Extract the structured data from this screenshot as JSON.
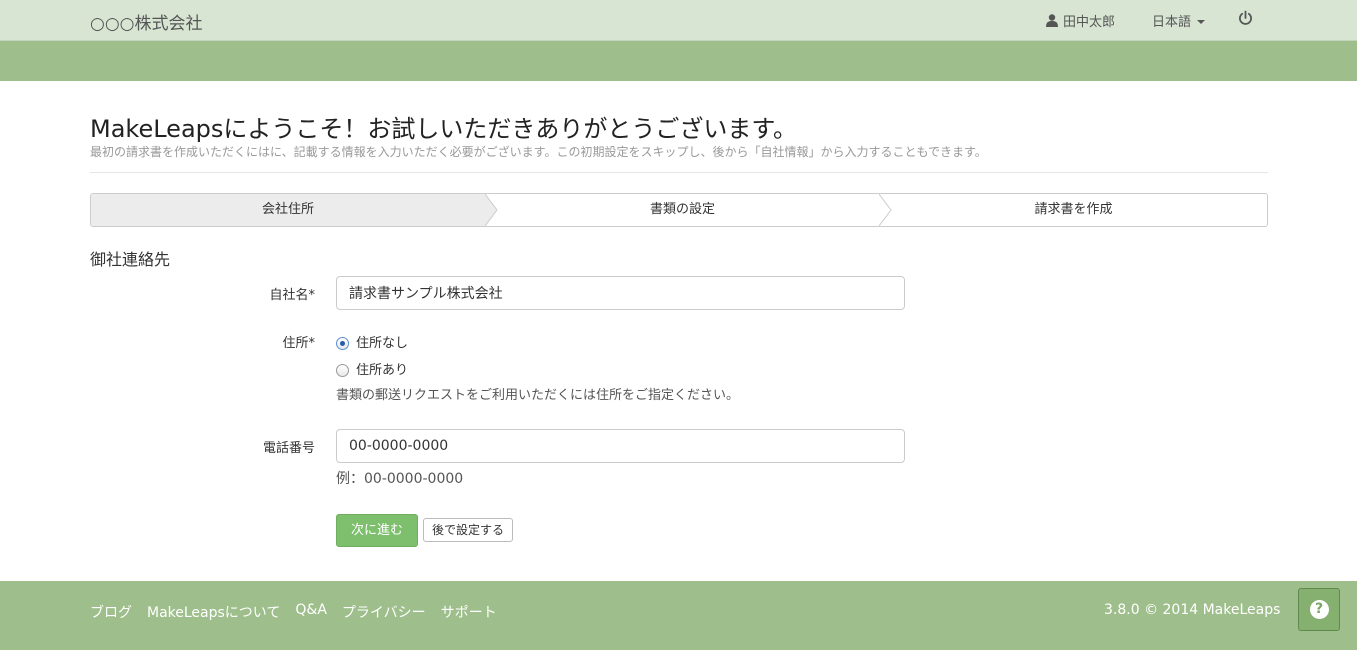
{
  "navbar": {
    "brand": "○○○株式会社",
    "user_name": "田中太郎",
    "language": "日本語"
  },
  "welcome": {
    "title": "MakeLeapsにようこそ！お試しいただきありがとうございます。",
    "subtitle": "最初の請求書を作成いただくにはに、記載する情報を入力いただく必要がございます。この初期設定をスキップし、後から「自社情報」から入力することもできます。"
  },
  "steps": [
    {
      "label": "会社住所",
      "active": true
    },
    {
      "label": "書類の設定",
      "active": false
    },
    {
      "label": "請求書を作成",
      "active": false
    }
  ],
  "form": {
    "section_title": "御社連絡先",
    "company_label": "自社名*",
    "company_value": "請求書サンプル株式会社",
    "address_label": "住所*",
    "address_options": [
      {
        "label": "住所なし",
        "checked": true
      },
      {
        "label": "住所あり",
        "checked": false
      }
    ],
    "address_help": "書類の郵送リクエストをご利用いただくには住所をご指定ください。",
    "phone_label": "電話番号",
    "phone_value": "00-0000-0000",
    "phone_help": "例：00-0000-0000",
    "next_button": "次に進む",
    "later_button": "後で設定する"
  },
  "footer": {
    "links": [
      "ブログ",
      "MakeLeapsについて",
      "Q&A",
      "プライバシー",
      "サポート"
    ],
    "copyright": "3.8.0 © 2014 MakeLeaps",
    "help_label": "?"
  },
  "colors": {
    "navbar_bg": "#d7e5d2",
    "band_green": "#9ebf8c",
    "primary_button": "#7dbf6c"
  },
  "icons": {
    "user": "user-icon",
    "power": "power-icon",
    "help": "question-icon"
  }
}
